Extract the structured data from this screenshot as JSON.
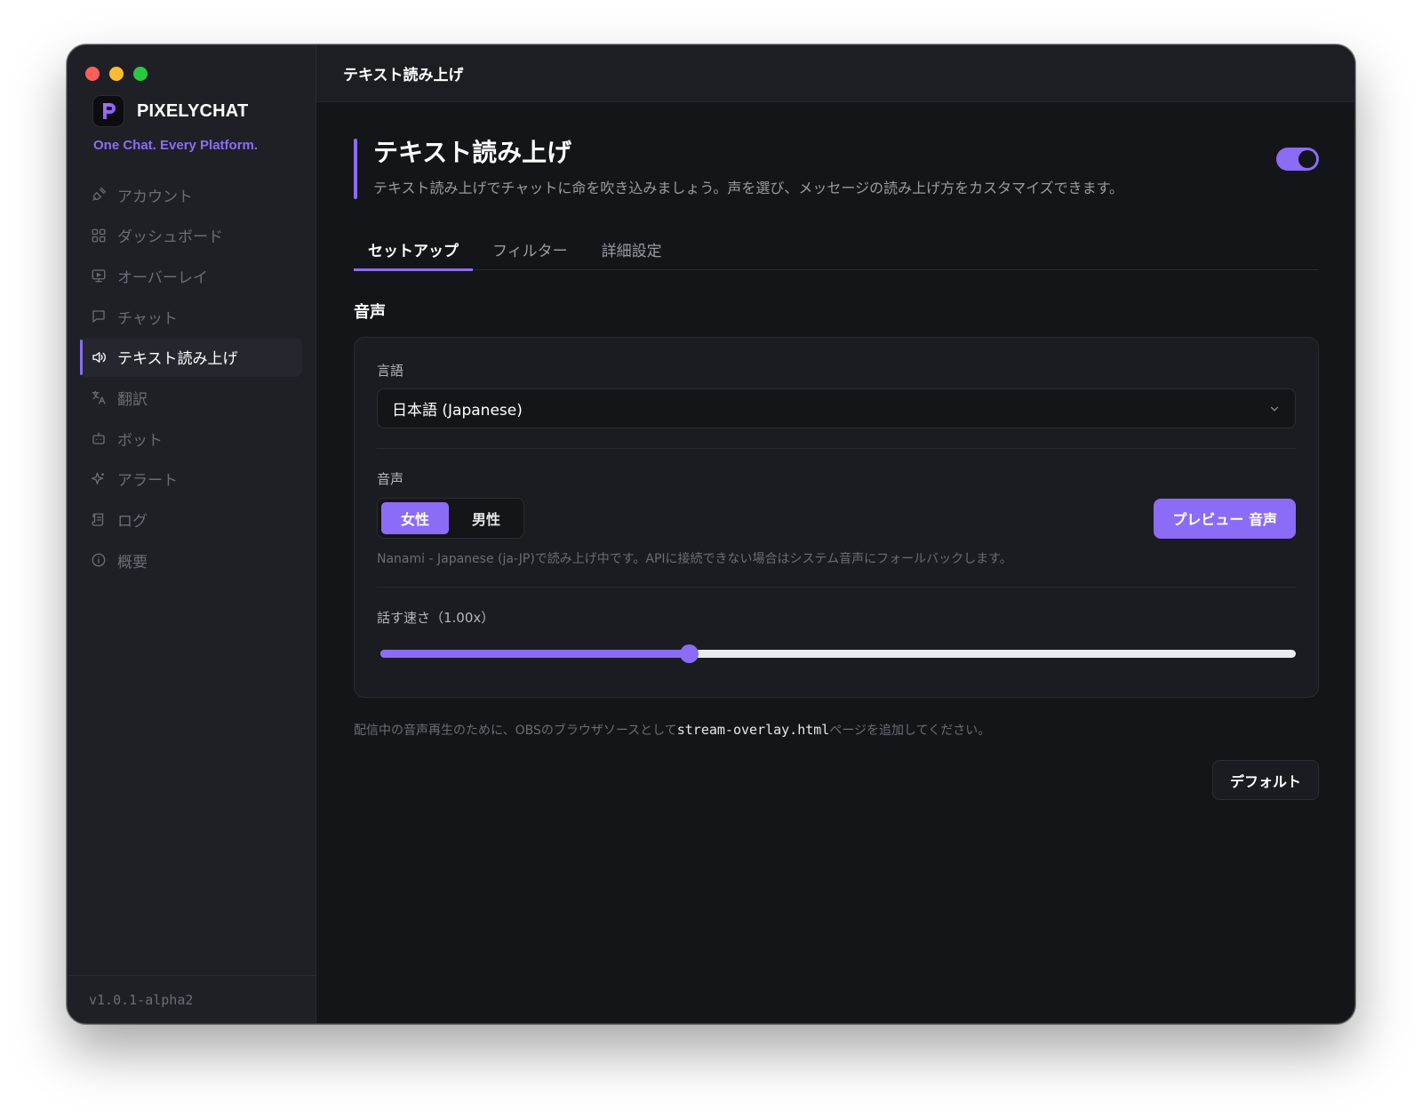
{
  "window": {
    "title_bar": "テキスト読み上げ"
  },
  "sidebar": {
    "brand_name": "PIXELYCHAT",
    "tagline": "One Chat. Every Platform.",
    "items": [
      {
        "label": "アカウント",
        "icon": "plug-icon"
      },
      {
        "label": "ダッシュボード",
        "icon": "grid-icon"
      },
      {
        "label": "オーバーレイ",
        "icon": "monitor-icon"
      },
      {
        "label": "チャット",
        "icon": "chat-bubble-icon"
      },
      {
        "label": "テキスト読み上げ",
        "icon": "speaker-icon",
        "active": true
      },
      {
        "label": "翻訳",
        "icon": "translate-icon"
      },
      {
        "label": "ボット",
        "icon": "robot-icon"
      },
      {
        "label": "アラート",
        "icon": "sparkle-icon"
      },
      {
        "label": "ログ",
        "icon": "scroll-icon"
      },
      {
        "label": "概要",
        "icon": "info-icon"
      }
    ],
    "version": "v1.0.1-alpha2"
  },
  "main": {
    "title": "テキスト読み上げ",
    "description": "テキスト読み上げでチャットに命を吹き込みましょう。声を選び、メッセージの読み上げ方をカスタマイズできます。",
    "enabled": true,
    "tabs": [
      {
        "label": "セットアップ",
        "active": true
      },
      {
        "label": "フィルター"
      },
      {
        "label": "詳細設定"
      }
    ],
    "section_title": "音声",
    "language": {
      "label": "言語",
      "value": "日本語 (Japanese)"
    },
    "voice": {
      "label": "音声",
      "options": [
        "女性",
        "男性"
      ],
      "selected": "女性",
      "preview_label": "プレビュー 音声",
      "hint": "Nanami - Japanese (ja-JP)で読み上げ中です。APIに接続できない場合はシステム音声にフォールバックします。"
    },
    "speed": {
      "label": "話す速さ（1.00x）",
      "fraction": 0.337
    },
    "footnote": {
      "prefix": "配信中の音声再生のために、OBSのブラウザソースとして",
      "code": "stream-overlay.html",
      "suffix": "ページを追加してください。"
    },
    "default_label": "デフォルト"
  },
  "colors": {
    "accent": "#8b6cf6",
    "background": "#141519",
    "sidebar": "#1f2026",
    "close": "#ff5f57",
    "minimize": "#febc2e",
    "maximize": "#28c840"
  }
}
